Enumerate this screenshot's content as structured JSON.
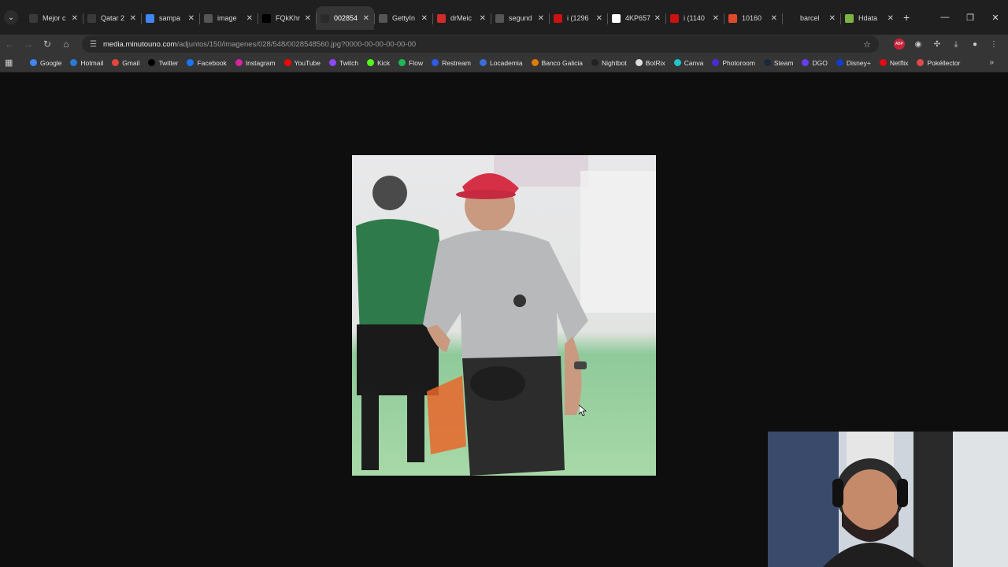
{
  "tabs": [
    {
      "title": "Mejor c",
      "color": "#3a3a3a"
    },
    {
      "title": "Qatar 2",
      "color": "#3a3a3a"
    },
    {
      "title": "sampa",
      "color": "#4285f4"
    },
    {
      "title": "image",
      "color": "#555555"
    },
    {
      "title": "FQkKhr",
      "color": "#000000"
    },
    {
      "title": "002854",
      "color": "#2a2a2a",
      "active": true
    },
    {
      "title": "GettyIn",
      "color": "#555555"
    },
    {
      "title": "drMeic",
      "color": "#d12b2b"
    },
    {
      "title": "segund",
      "color": "#555555"
    },
    {
      "title": "i (1296",
      "color": "#cc1111"
    },
    {
      "title": "4KP657",
      "color": "#ffffff"
    },
    {
      "title": "i (1140",
      "color": "#cc1111"
    },
    {
      "title": "10160",
      "color": "#e04a2a"
    },
    {
      "title": "barcel",
      "color": "#1f1f1f"
    },
    {
      "title": "Hdata",
      "color": "#7cb342"
    }
  ],
  "window_controls": {
    "minimize": "—",
    "restore": "❐",
    "close": "✕"
  },
  "address": {
    "host": "media.minutouno.com",
    "path": "/adjuntos/150/imagenes/028/548/0028548560.jpg?0000-00-00-00-00-00"
  },
  "toolbar": {
    "back": "←",
    "forward": "→",
    "reload": "↻",
    "home": "⌂",
    "star": "☆",
    "abp": "ABP",
    "download": "⤓",
    "menu": "⋮"
  },
  "bookmarks": [
    {
      "label": "Google",
      "color": "#4285f4"
    },
    {
      "label": "Hotmail",
      "color": "#2a7bd4"
    },
    {
      "label": "Gmail",
      "color": "#e8453c"
    },
    {
      "label": "Twitter",
      "color": "#000000"
    },
    {
      "label": "Facebook",
      "color": "#1877f2"
    },
    {
      "label": "Instagram",
      "color": "#d6249f"
    },
    {
      "label": "YouTube",
      "color": "#ff0000"
    },
    {
      "label": "Twitch",
      "color": "#9146ff"
    },
    {
      "label": "Kick",
      "color": "#53fc18"
    },
    {
      "label": "Flow",
      "color": "#1db954"
    },
    {
      "label": "Restream",
      "color": "#2f5bea"
    },
    {
      "label": "Locademia",
      "color": "#3b6fd8"
    },
    {
      "label": "Banco Galicia",
      "color": "#e07b00"
    },
    {
      "label": "Nightbot",
      "color": "#222222"
    },
    {
      "label": "BotRix",
      "color": "#dddddd"
    },
    {
      "label": "Canva",
      "color": "#20c4cb"
    },
    {
      "label": "Photoroom",
      "color": "#4b2bd6"
    },
    {
      "label": "Steam",
      "color": "#1b2838"
    },
    {
      "label": "DGO",
      "color": "#6a3df5"
    },
    {
      "label": "Disney+",
      "color": "#113ccf"
    },
    {
      "label": "Netflix",
      "color": "#e50914"
    },
    {
      "label": "Pokéllector",
      "color": "#e24a4a"
    }
  ],
  "bookmarks_more": "»",
  "apps_icon": "apps-grid-icon"
}
